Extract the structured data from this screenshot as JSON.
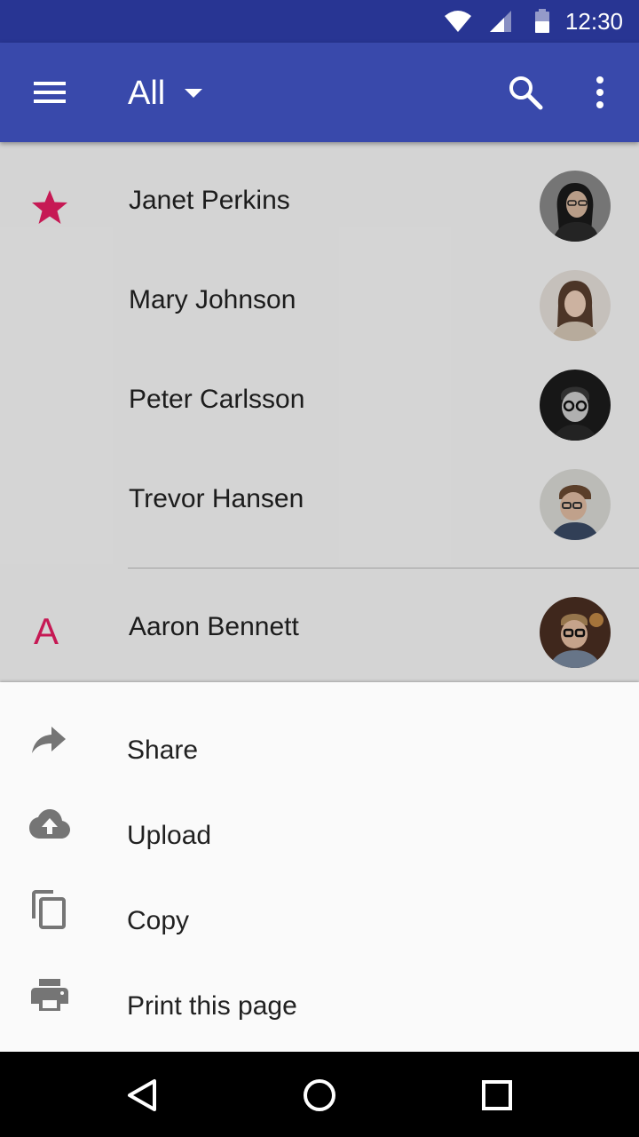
{
  "status_bar": {
    "time": "12:30",
    "icons": [
      "wifi-icon",
      "cell-signal-icon",
      "battery-icon"
    ]
  },
  "app_bar": {
    "title": "All",
    "icons": [
      "menu-icon",
      "dropdown-arrow-icon",
      "search-icon",
      "more-vert-icon"
    ]
  },
  "contacts": [
    {
      "name": "Janet Perkins",
      "starred": true
    },
    {
      "name": "Mary Johnson",
      "starred": false
    },
    {
      "name": "Peter Carlsson",
      "starred": false
    },
    {
      "name": "Trevor Hansen",
      "starred": false
    },
    {
      "name": "Aaron Bennett",
      "starred": false,
      "section_letter": "A"
    }
  ],
  "bottom_sheet": {
    "items": [
      {
        "label": "Share",
        "icon": "share-icon"
      },
      {
        "label": "Upload",
        "icon": "cloud-upload-icon"
      },
      {
        "label": "Copy",
        "icon": "copy-icon"
      },
      {
        "label": "Print this page",
        "icon": "print-icon"
      }
    ]
  },
  "nav_bar": {
    "icons": [
      "back-icon",
      "home-icon",
      "recents-icon"
    ]
  },
  "colors": {
    "status_bar": "#283593",
    "app_bar": "#3949ab",
    "accent": "#e91e63",
    "sheet_background": "#fafafa",
    "icon_gray": "#757575"
  }
}
